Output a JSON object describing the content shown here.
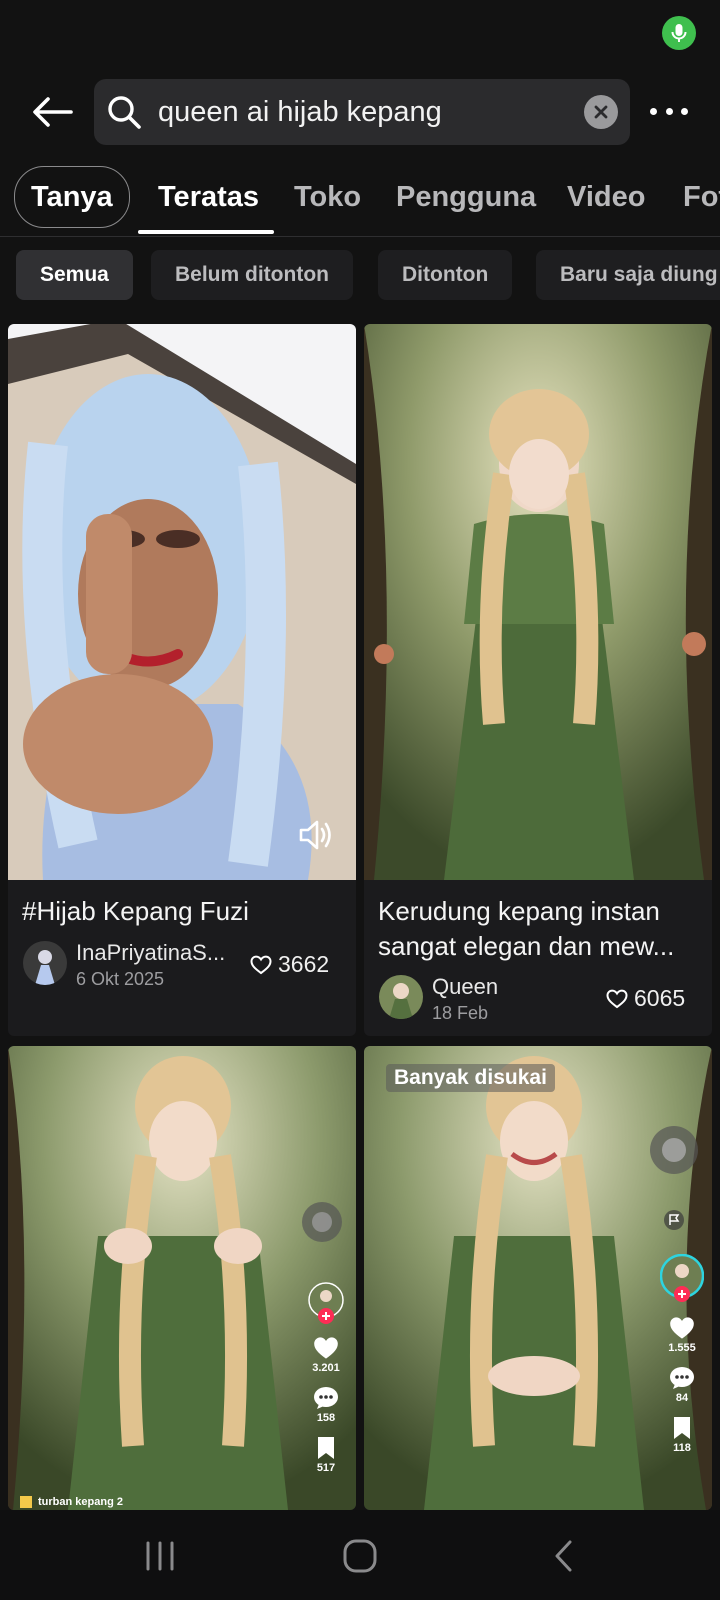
{
  "search": {
    "query": "queen ai hijab kepang"
  },
  "tabs": [
    {
      "label": "Tanya"
    },
    {
      "label": "Teratas"
    },
    {
      "label": "Toko"
    },
    {
      "label": "Pengguna"
    },
    {
      "label": "Video"
    },
    {
      "label": "Fot"
    }
  ],
  "filters": [
    {
      "label": "Semua"
    },
    {
      "label": "Belum ditonton"
    },
    {
      "label": "Ditonton"
    },
    {
      "label": "Baru saja diung"
    }
  ],
  "results": [
    {
      "title": "#Hijab Kepang Fuzi",
      "author": "InaPriyatinaS...",
      "date": "6 Okt 2025",
      "likes": "3662"
    },
    {
      "title": "Kerudung kepang instan sangat elegan dan mew...",
      "author": "Queen",
      "date": "18 Feb",
      "likes": "6065"
    },
    {
      "caption": "turban kepang 2",
      "side_likes": "3.201",
      "side_comments": "158",
      "side_saves": "517"
    },
    {
      "badge": "Banyak disukai",
      "side_likes": "1.555",
      "side_comments": "84",
      "side_saves": "118"
    }
  ],
  "colors": {
    "background": "#121212",
    "card": "#1b1b1d",
    "search_box": "#2b2b2d",
    "mic_indicator": "#3fbf4e",
    "tiktok_red": "#fe2c55"
  }
}
